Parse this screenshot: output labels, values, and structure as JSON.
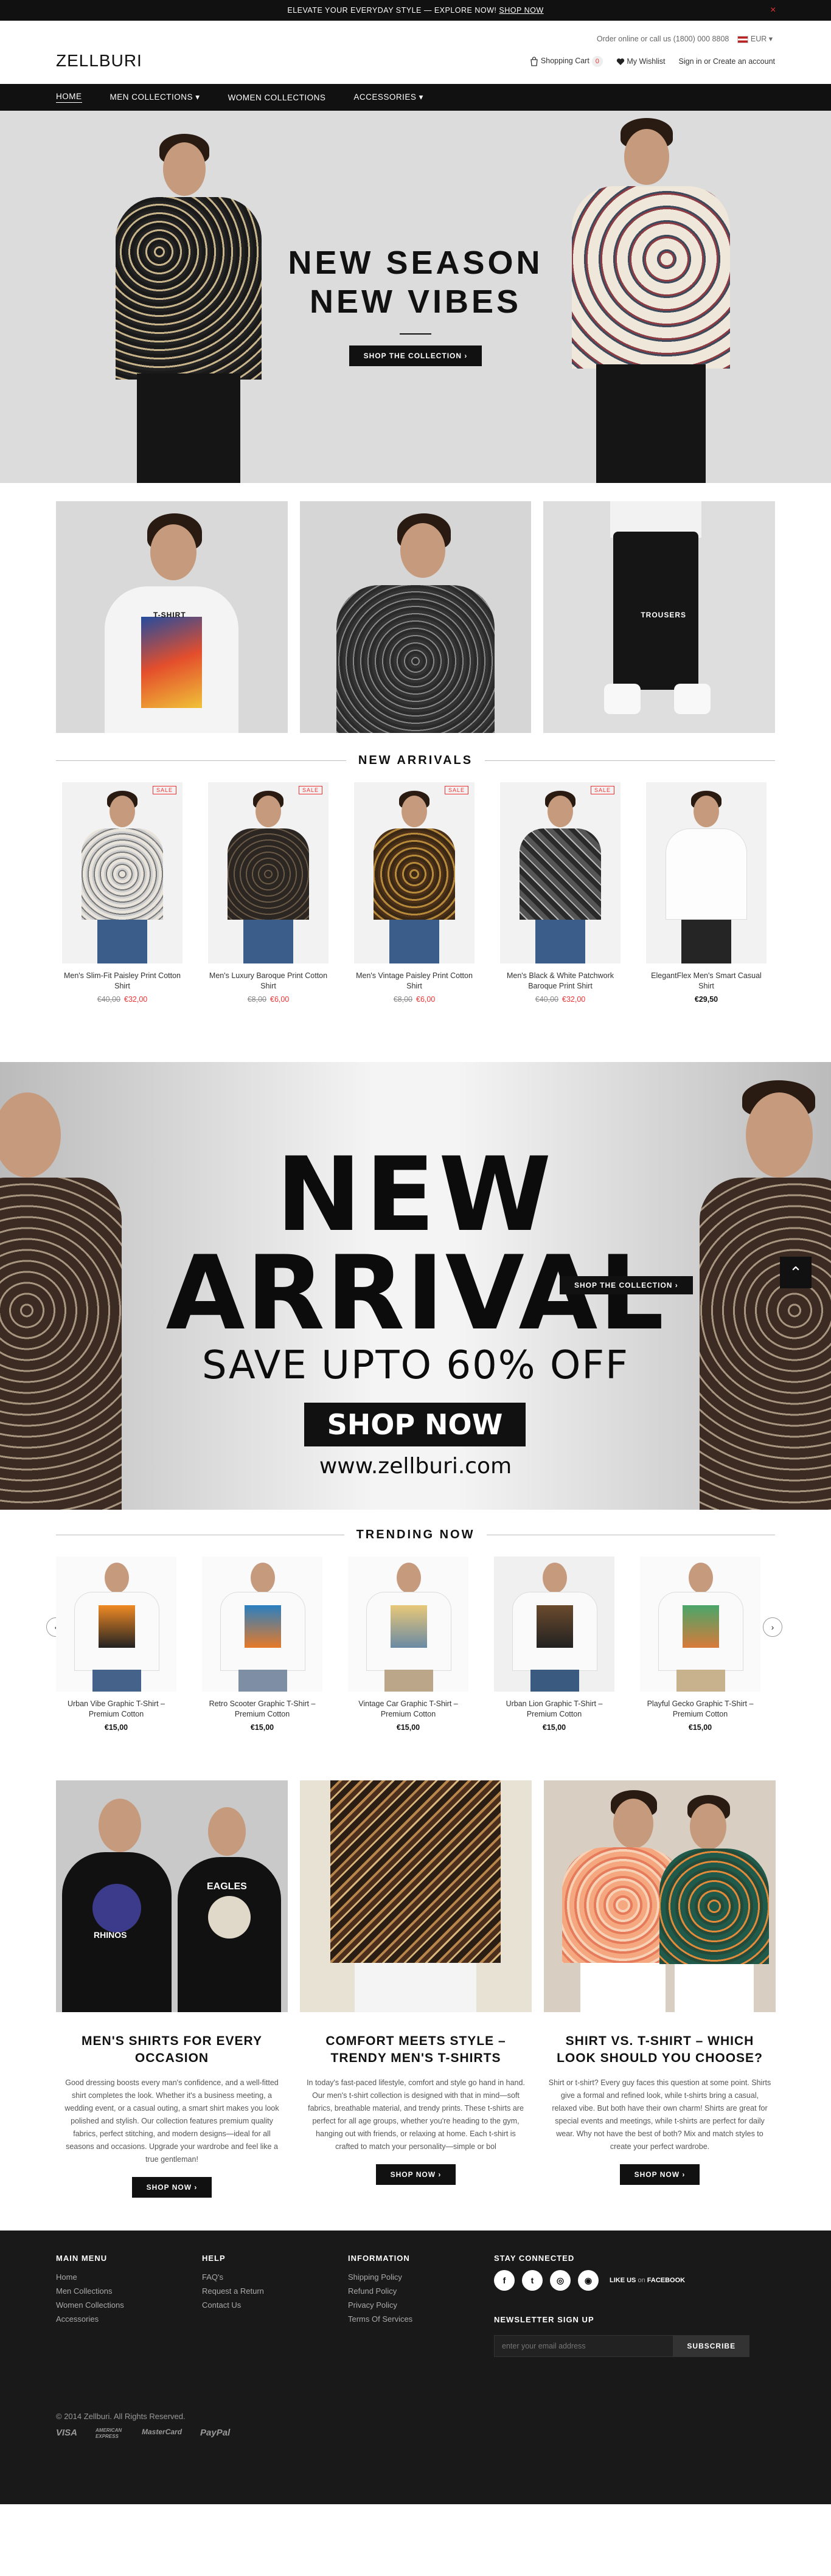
{
  "topbar": {
    "text": "ELEVATE YOUR EVERYDAY STYLE — EXPLORE NOW!",
    "link": "SHOP NOW",
    "close": "×"
  },
  "header": {
    "contact": "Order online or call us (1800) 000 8808",
    "currency": "EUR ▾",
    "logo": "ZELLBURI",
    "cart_label": "Shopping Cart",
    "cart_count": "0",
    "wishlist_label": "My Wishlist",
    "sign_in": "Sign in",
    "or": "or",
    "create_account": "Create an account"
  },
  "nav": {
    "items": [
      "HOME",
      "MEN COLLECTIONS ▾",
      "WOMEN COLLECTIONS",
      "ACCESSORIES ▾"
    ]
  },
  "hero": {
    "line1": "NEW SEASON",
    "line2": "NEW VIBES",
    "button": "SHOP THE COLLECTION  ›"
  },
  "categories": {
    "tshirt": "T-SHIRT",
    "trousers": "TROUSERS"
  },
  "new_arrivals": {
    "title": "NEW ARRIVALS",
    "sale_badge": "SALE",
    "items": [
      {
        "name": "Men's Slim-Fit Paisley Print Cotton Shirt",
        "old": "€40,00",
        "price": "€32,00"
      },
      {
        "name": "Men's Luxury Baroque Print Cotton Shirt",
        "old": "€8,00",
        "price": "€6,00"
      },
      {
        "name": "Men's Vintage Paisley Print Cotton Shirt",
        "old": "€8,00",
        "price": "€6,00"
      },
      {
        "name": "Men's Black & White Patchwork Baroque Print Shirt",
        "old": "€40,00",
        "price": "€32,00"
      },
      {
        "name": "ElegantFlex Men's Smart Casual Shirt",
        "old": "",
        "price": "€29,50"
      }
    ]
  },
  "promo": {
    "line1": "NEW",
    "line2": "ARRIVAL",
    "line3": "SAVE UPTO 60% OFF",
    "shop_now": "SHOP NOW",
    "url": "www.zellburi.com",
    "overlay_button": "SHOP THE COLLECTION  ›",
    "scroll_top": "⌃"
  },
  "trending": {
    "title": "TRENDING NOW",
    "prev": "‹",
    "next": "›",
    "items": [
      {
        "name": "Urban Vibe Graphic T-Shirt – Premium Cotton",
        "price": "€15,00"
      },
      {
        "name": "Retro Scooter Graphic T-Shirt – Premium Cotton",
        "price": "€15,00"
      },
      {
        "name": "Vintage Car Graphic T-Shirt – Premium Cotton",
        "price": "€15,00"
      },
      {
        "name": "Urban Lion Graphic T-Shirt – Premium Cotton",
        "price": "€15,00"
      },
      {
        "name": "Playful Gecko Graphic T-Shirt – Premium Cotton",
        "price": "€15,00"
      }
    ]
  },
  "blogs": [
    {
      "title": "MEN'S SHIRTS FOR EVERY OCCASION",
      "text": "Good dressing boosts every man's confidence, and a well-fitted shirt completes the look. Whether it's a business meeting, a wedding event, or a casual outing, a smart shirt makes you look polished and stylish. Our collection features premium quality fabrics, perfect stitching, and modern designs—ideal for all seasons and occasions. Upgrade your wardrobe and feel like a true gentleman!",
      "button": "SHOP NOW  ›"
    },
    {
      "title": "COMFORT MEETS STYLE – TRENDY MEN'S T-SHIRTS",
      "text": "In today's fast-paced lifestyle, comfort and style go hand in hand. Our men's t-shirt collection is designed with that in mind—soft fabrics, breathable material, and trendy prints. These t-shirts are perfect for all age groups, whether you're heading to the gym, hanging out with friends, or relaxing at home. Each t-shirt is crafted to match your personality—simple or bol",
      "button": "SHOP NOW  ›"
    },
    {
      "title": "SHIRT VS. T-SHIRT – WHICH LOOK SHOULD YOU CHOOSE?",
      "text": "Shirt or t-shirt? Every guy faces this question at some point. Shirts give a formal and refined look, while t-shirts bring a casual, relaxed vibe. But both have their own charm! Shirts are great for special events and meetings, while t-shirts are perfect for daily wear. Why not have the best of both? Mix and match styles to create your perfect wardrobe.",
      "button": "SHOP NOW  ›"
    }
  ],
  "blog_prints": {
    "b1": "RHINOS",
    "b2": "EAGLES"
  },
  "footer": {
    "main_menu": {
      "title": "MAIN MENU",
      "links": [
        "Home",
        "Men Collections",
        "Women Collections",
        "Accessories"
      ]
    },
    "help": {
      "title": "HELP",
      "links": [
        "FAQ's",
        "Request a Return",
        "Contact Us"
      ]
    },
    "information": {
      "title": "INFORMATION",
      "links": [
        "Shipping Policy",
        "Refund Policy",
        "Privacy Policy",
        "Terms Of Services"
      ]
    },
    "stay_connected": "STAY CONNECTED",
    "like_us": "LIKE US",
    "on": "on",
    "facebook": "FACEBOOK",
    "newsletter": "NEWSLETTER SIGN UP",
    "email_placeholder": "enter your email address",
    "subscribe": "SUBSCRIBE",
    "copyright": "© 2014 Zellburi. All Rights Reserved.",
    "payments": [
      "VISA",
      "AMERICAN EXPRESS",
      "MasterCard",
      "PayPal"
    ]
  },
  "colors": {
    "sale_red": "#e33333",
    "dark": "#111111",
    "footer_bg": "#191919"
  }
}
